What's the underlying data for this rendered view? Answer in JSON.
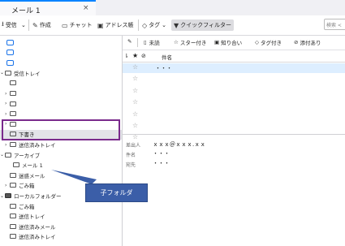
{
  "tab": {
    "title": "メール 1",
    "close": "×"
  },
  "toolbar": {
    "receive": "受信",
    "compose": "作成",
    "chat": "チャット",
    "addressbook": "アドレス帳",
    "tag": "タグ",
    "quickfilter": "クイックフィルター",
    "search_placeholder": "検索 <"
  },
  "filterbar": {
    "unread": "未読",
    "starred": "スター付き",
    "contacts": "知り合い",
    "tagged": "タグ付き",
    "attachment": "添付あり"
  },
  "list": {
    "column_subject": "件名",
    "rows": [
      "・・・",
      "",
      "",
      "",
      "",
      "",
      ""
    ]
  },
  "folders": [
    {
      "label": "",
      "type": "account"
    },
    {
      "label": "",
      "type": "account"
    },
    {
      "label": "",
      "type": "account"
    },
    {
      "label": "受信トレイ",
      "type": "folder",
      "twisty": "⌄"
    },
    {
      "label": "",
      "type": "folder",
      "twisty": ""
    },
    {
      "label": "",
      "type": "folder",
      "twisty": "›"
    },
    {
      "label": "",
      "type": "folder",
      "twisty": "›"
    },
    {
      "label": "",
      "type": "folder",
      "twisty": "›"
    },
    {
      "label": "",
      "type": "folder",
      "twisty": "›"
    },
    {
      "label": "下書き",
      "type": "folder",
      "twisty": ""
    },
    {
      "label": "送信済みトレイ",
      "type": "folder",
      "twisty": "›"
    },
    {
      "label": "アーカイブ",
      "type": "folder",
      "twisty": "⌄"
    },
    {
      "label": "メール 1",
      "type": "folder",
      "twisty": ""
    },
    {
      "label": "迷惑メール",
      "type": "folder",
      "twisty": ""
    },
    {
      "label": "ごみ箱",
      "type": "folder",
      "twisty": "›"
    },
    {
      "label": "ローカルフォルダー",
      "type": "local",
      "twisty": "⌄"
    },
    {
      "label": "ごみ箱",
      "type": "folder",
      "twisty": ""
    },
    {
      "label": "送信トレイ",
      "type": "folder",
      "twisty": ""
    },
    {
      "label": "送信済みメール",
      "type": "folder",
      "twisty": ""
    },
    {
      "label": "送信済みトレイ",
      "type": "folder",
      "twisty": ""
    }
  ],
  "preview": {
    "from_label": "差出人",
    "from": "ｘｘｘ＠ｘｘｘ.ｘｘ",
    "subject_label": "件名",
    "subject": "・・・",
    "to_label": "宛先",
    "to": "・・・"
  },
  "callout": "子フォルダ",
  "colors": {
    "highlight_box": "#7a2a8c",
    "callout_bg": "#3b5ea8",
    "accent": "#0a84ff"
  }
}
